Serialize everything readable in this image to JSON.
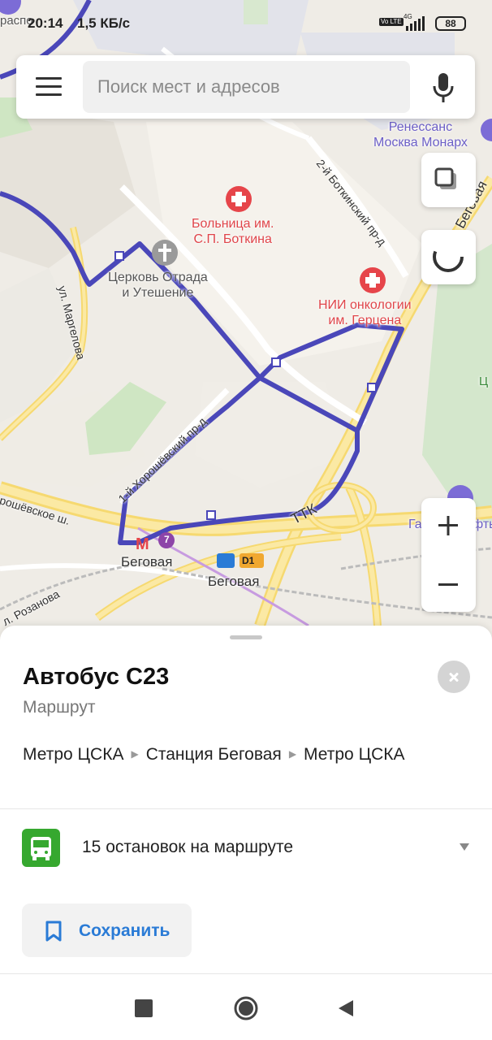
{
  "status_bar": {
    "time": "20:14",
    "speed": "1,5 КБ/с",
    "volte": "Vo LTE",
    "network": "4G",
    "battery": "88"
  },
  "search": {
    "placeholder": "Поиск мест и адресов"
  },
  "map": {
    "route_color": "#4a47b9",
    "labels": {
      "hospital": "Больница им.\nС.П. Боткина",
      "church": "Церковь Отрада\nи Утешение",
      "oncology": "НИИ онкологии\nим. Герцена",
      "hotel": "Ренессанс\nМосква Монарх",
      "metro_begovaya": "Беговая",
      "metro_line": "7",
      "station_begovaya": "Беговая",
      "d1": "D1",
      "gazprom": "Газпромнефть",
      "ttk": "ТТК",
      "top_left": "распо",
      "edge_c": "Ц"
    },
    "streets": {
      "margelova": "ул. Маргелова",
      "botkinsky": "2-й Боткинский пр-д",
      "khoroshevsky_pr": "1-й Хорошёвский пр-д",
      "khoroshevskoe": "рошёвское ш.",
      "rozanova": "л. Розанова",
      "begovaya_st": "Беговая"
    }
  },
  "sheet": {
    "title": "Автобус С23",
    "subtitle": "Маршрут",
    "route_stops": [
      "Метро ЦСКА",
      "Станция Беговая",
      "Метро ЦСКА"
    ],
    "stops_count": "15 остановок на маршруте",
    "save_label": "Сохранить"
  },
  "colors": {
    "accent": "#2a7bd6",
    "bus_green": "#36a82f",
    "route": "#4a47b9"
  }
}
